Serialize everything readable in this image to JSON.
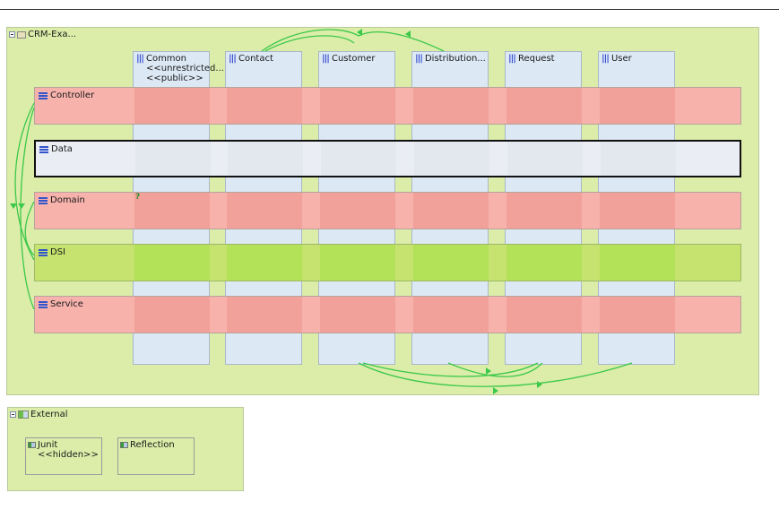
{
  "main_panel": {
    "title": "CRM-Exa..."
  },
  "columns": [
    {
      "name": "Common",
      "stereotypes": [
        "<<unrestricted...",
        "<<public>>"
      ]
    },
    {
      "name": "Contact",
      "stereotypes": []
    },
    {
      "name": "Customer",
      "stereotypes": []
    },
    {
      "name": "Distribution...",
      "stereotypes": []
    },
    {
      "name": "Request",
      "stereotypes": []
    },
    {
      "name": "User",
      "stereotypes": []
    }
  ],
  "layers": [
    {
      "name": "Controller",
      "color": "#f7b2ac",
      "cell_color": "#f2a09a"
    },
    {
      "name": "Data",
      "color": "#eaedf3",
      "cell_color": "#e3e8ef",
      "selected": true
    },
    {
      "name": "Domain",
      "color": "#f7b2ac",
      "cell_color": "#f2a09a",
      "marker": "?"
    },
    {
      "name": "DSI",
      "color": "#c5e36e",
      "cell_color": "#b3e258"
    },
    {
      "name": "Service",
      "color": "#f7b2ac",
      "cell_color": "#f2a09a"
    }
  ],
  "external_panel": {
    "title": "External",
    "components": [
      {
        "name": "Junit",
        "stereotype": "<<hidden>>",
        "color": "#f7b2ac"
      },
      {
        "name": "Reflection",
        "stereotype": "",
        "color": "#c5e36e"
      }
    ]
  },
  "colors": {
    "panel_bg": "#dbeda9",
    "column_bg": "#dce9f5",
    "dependency_arrow": "#3cc84a"
  }
}
